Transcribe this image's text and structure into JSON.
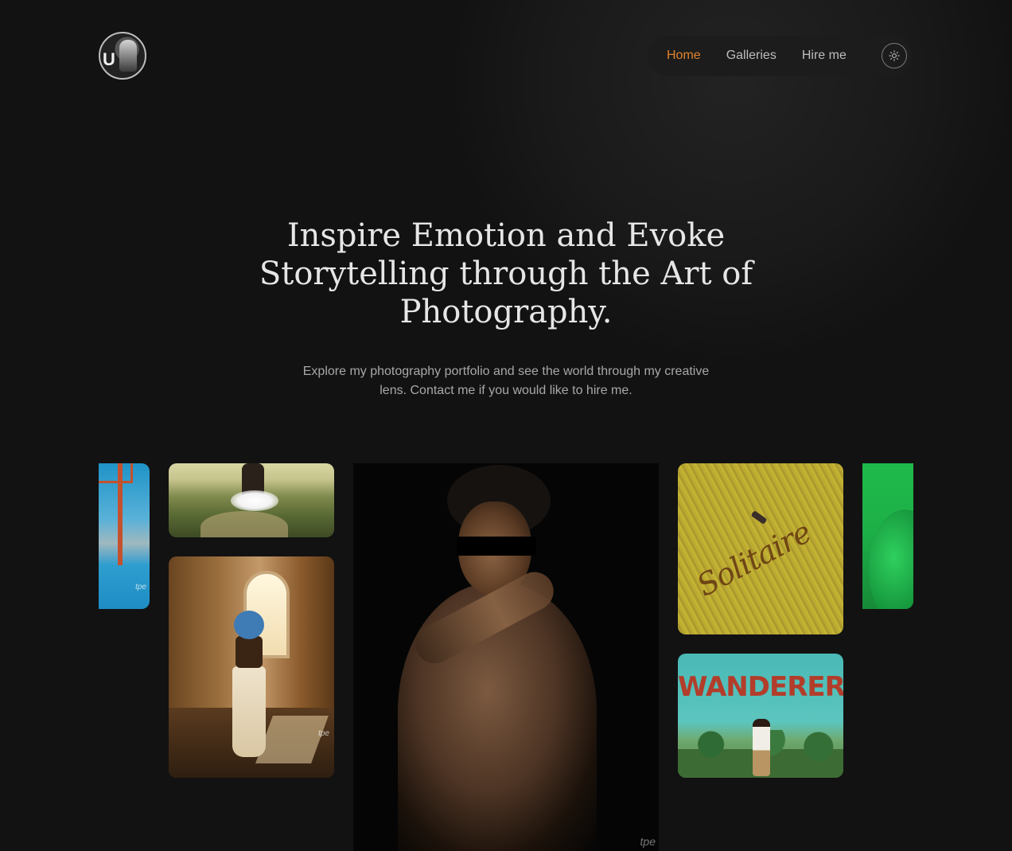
{
  "header": {
    "avatar_letter": "U",
    "nav": {
      "items": [
        {
          "label": "Home",
          "active": true
        },
        {
          "label": "Galleries",
          "active": false
        },
        {
          "label": "Hire me",
          "active": false
        }
      ],
      "theme_toggle_icon": "sun-icon",
      "accent_color": "#e0832a"
    }
  },
  "hero": {
    "title": "Inspire Emotion and Evoke Storytelling through the Art of Photography.",
    "subtitle": "Explore my photography portfolio and see the world through my creative lens. Contact me if you would like to hire me."
  },
  "gallery": {
    "photos": [
      {
        "name": "basketball-court-photo",
        "watermark": "tpe"
      },
      {
        "name": "white-tutu-field-photo",
        "watermark": ""
      },
      {
        "name": "window-room-photo",
        "watermark": "tpe"
      },
      {
        "name": "portrait-photo",
        "watermark": "tpe"
      },
      {
        "name": "solitaire-photo",
        "text": "Solitaire"
      },
      {
        "name": "wanderer-photo",
        "text": "WANDERER."
      },
      {
        "name": "green-photo",
        "watermark": ""
      }
    ]
  }
}
